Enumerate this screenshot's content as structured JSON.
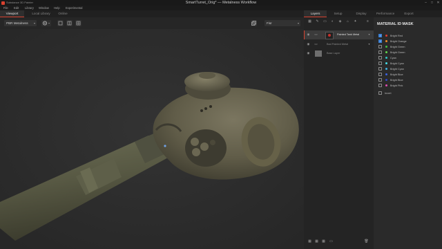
{
  "window": {
    "app_name": "Substance 3D Painter",
    "title": "SmartTurret_Orig* — Metalness Workflow",
    "controls": [
      "–",
      "□",
      "✕"
    ]
  },
  "menu": [
    "File",
    "Edit",
    "Library",
    "Window",
    "Help",
    "Experimental"
  ],
  "left_tabs": [
    "Viewport",
    "Local Library",
    "Online"
  ],
  "right_tabs": [
    "Layers",
    "Setup",
    "Display",
    "Performance",
    "Export"
  ],
  "toolbar": {
    "shading_mode": "PBR Metalness",
    "view_mode": "Fisr"
  },
  "layers": [
    {
      "name": "Painted Tank Metal",
      "selected": true,
      "type": "folder"
    },
    {
      "name": "Bad Painted Metal",
      "selected": false,
      "type": "folder"
    },
    {
      "name": "Base Layer",
      "selected": false,
      "type": "layer"
    }
  ],
  "mask_panel": {
    "title": "MATERIAL ID MASK",
    "items": [
      {
        "label": "Bright Red",
        "checked": true,
        "color": "#e23b2e"
      },
      {
        "label": "Bright Orange",
        "checked": true,
        "color": "#f08a24"
      },
      {
        "label": "Bright Green",
        "checked": false,
        "color": "#3fbf3f"
      },
      {
        "label": "Bright Green",
        "checked": false,
        "color": "#62d94a"
      },
      {
        "label": "Cyan",
        "checked": false,
        "color": "#2fc7c7"
      },
      {
        "label": "Bright Cyan",
        "checked": false,
        "color": "#45e0e8"
      },
      {
        "label": "Bright Cyan",
        "checked": false,
        "color": "#3fb0e0"
      },
      {
        "label": "Bright Blue",
        "checked": false,
        "color": "#3a62e0"
      },
      {
        "label": "Bright Blue",
        "checked": false,
        "color": "#2f45c8"
      },
      {
        "label": "Bright Pink",
        "checked": false,
        "color": "#e04bb0"
      }
    ],
    "invert_label": "Invert",
    "invert_checked": false
  },
  "colors": {
    "accent": "#d9412f",
    "selection_blue": "#3a7fd5"
  }
}
